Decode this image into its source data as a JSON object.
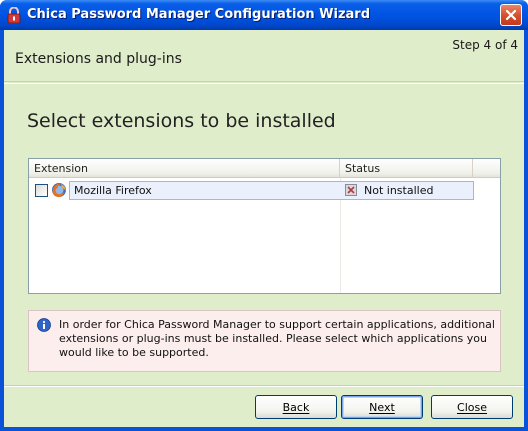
{
  "window": {
    "title": "Chica Password Manager Configuration Wizard"
  },
  "header": {
    "page_title": "Extensions and plug-ins",
    "step": "Step 4 of 4"
  },
  "main": {
    "heading": "Select extensions to be installed",
    "list": {
      "columns": [
        "Extension",
        "Status"
      ],
      "rows": [
        {
          "name": "Mozilla Firefox",
          "status": "Not installed",
          "checked": false
        }
      ]
    },
    "info": "In order for Chica Password Manager to support certain applications, additional extensions or plug-ins must be installed. Please select which applications you would like to be supported."
  },
  "buttons": {
    "back": "Back",
    "next": "Next",
    "close": "Close"
  },
  "colors": {
    "titlebar": "#0054e3",
    "client_bg": "#e0edcb",
    "info_bg": "#fdeeee"
  },
  "icons": {
    "title": "lock-icon",
    "row": "firefox-icon",
    "status": "not-installed-icon",
    "info": "info-icon",
    "close": "close-icon"
  }
}
